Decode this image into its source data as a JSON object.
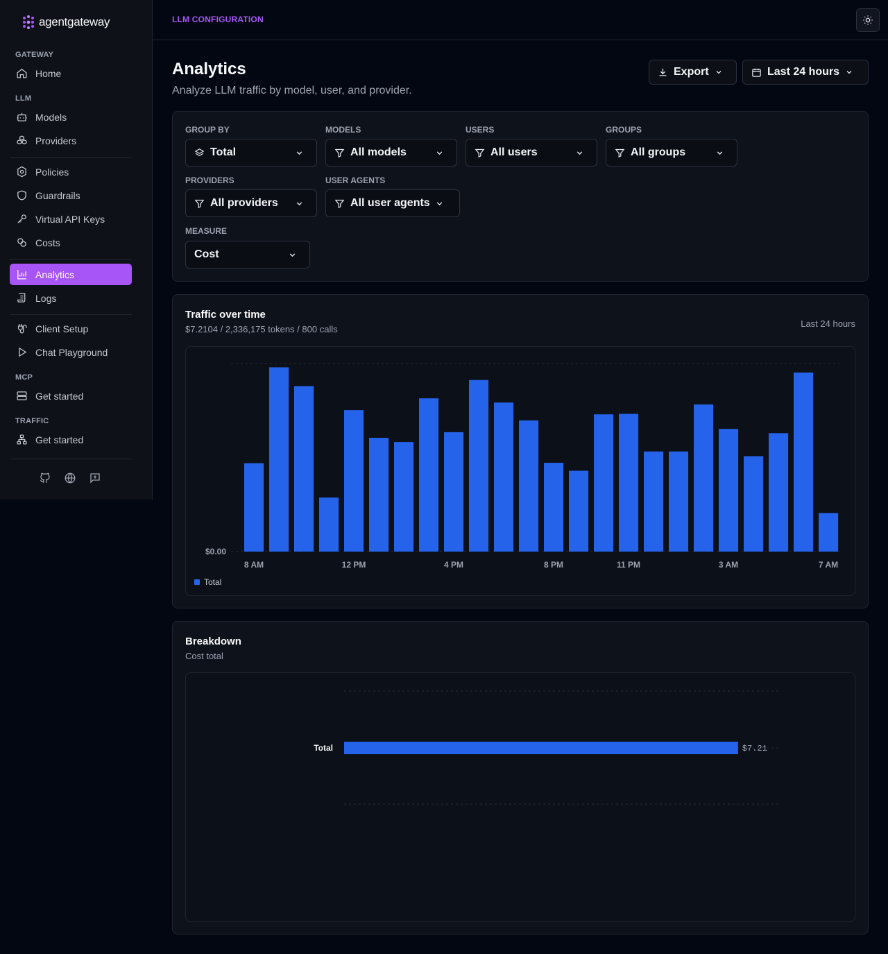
{
  "brand": {
    "name": "agentgateway",
    "accent": "#a855f7"
  },
  "sidebar": {
    "sections": {
      "gateway": "GATEWAY",
      "llm": "LLM",
      "mcp": "MCP",
      "traffic": "TRAFFIC"
    },
    "items": {
      "home": "Home",
      "models": "Models",
      "providers": "Providers",
      "policies": "Policies",
      "guardrails": "Guardrails",
      "virtual_keys": "Virtual API Keys",
      "costs": "Costs",
      "analytics": "Analytics",
      "logs": "Logs",
      "client_setup": "Client Setup",
      "chat_playground": "Chat Playground",
      "mcp_get_started": "Get started",
      "traffic_get_started": "Get started"
    }
  },
  "header": {
    "section_title": "LLM CONFIGURATION"
  },
  "page": {
    "title": "Analytics",
    "subtitle": "Analyze LLM traffic by model, user, and provider.",
    "export_label": "Export",
    "range_label": "Last 24 hours"
  },
  "filters": {
    "group_by": {
      "label": "GROUP BY",
      "value": "Total"
    },
    "models": {
      "label": "MODELS",
      "value": "All models"
    },
    "users": {
      "label": "USERS",
      "value": "All users"
    },
    "groups": {
      "label": "GROUPS",
      "value": "All groups"
    },
    "providers": {
      "label": "PROVIDERS",
      "value": "All providers"
    },
    "user_agents": {
      "label": "USER AGENTS",
      "value": "All user agents"
    },
    "measure": {
      "label": "MEASURE",
      "value": "Cost"
    }
  },
  "traffic": {
    "title": "Traffic over time",
    "summary": "$7.2104 / 2,336,175 tokens / 800 calls",
    "range_note": "Last 24 hours"
  },
  "breakdown": {
    "title": "Breakdown",
    "subtitle": "Cost total"
  },
  "chart_data": [
    {
      "type": "bar",
      "y_tick_label": "$0.00",
      "x_tick_labels": [
        "8 AM",
        "12 PM",
        "4 PM",
        "8 PM",
        "11 PM",
        "3 AM",
        "7 AM"
      ],
      "x_tick_positions": [
        0,
        4,
        8,
        12,
        15,
        19,
        23
      ],
      "series": [
        {
          "name": "Total",
          "color": "#2563eb",
          "values": [
            0.188,
            0.392,
            0.352,
            0.115,
            0.301,
            0.242,
            0.233,
            0.326,
            0.254,
            0.365,
            0.317,
            0.279,
            0.189,
            0.172,
            0.292,
            0.293,
            0.213,
            0.213,
            0.313,
            0.261,
            0.203,
            0.252,
            0.381,
            0.082
          ]
        }
      ],
      "ylim": [
        0,
        0.4
      ],
      "grid": true,
      "legend": "bottom-left"
    },
    {
      "type": "bar",
      "orientation": "horizontal",
      "categories": [
        "Total"
      ],
      "values": [
        7.21
      ],
      "value_labels": [
        "$7.21"
      ],
      "color": "#2563eb",
      "xlim": [
        0,
        8
      ]
    }
  ]
}
